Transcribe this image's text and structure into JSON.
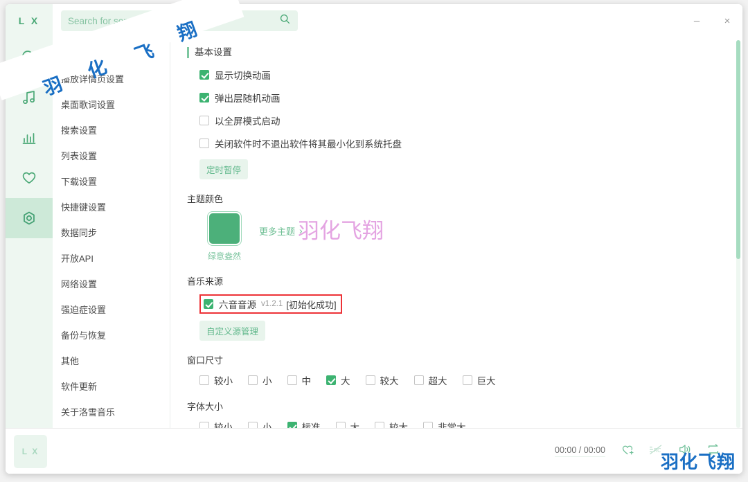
{
  "window": {
    "minimize_label": "–",
    "close_label": "×"
  },
  "rail": {
    "logo": "L X",
    "items": [
      {
        "name": "search",
        "label": "搜索"
      },
      {
        "name": "music-library",
        "label": "我的列表"
      },
      {
        "name": "ranking",
        "label": "排行榜"
      },
      {
        "name": "favorites",
        "label": "收藏"
      },
      {
        "name": "settings",
        "label": "设置"
      }
    ]
  },
  "search": {
    "placeholder": "Search for something...",
    "value": ""
  },
  "nav": {
    "group_label": "基本设置",
    "items": [
      "播放详情页设置",
      "桌面歌词设置",
      "搜索设置",
      "列表设置",
      "下载设置",
      "快捷键设置",
      "数据同步",
      "开放API",
      "网络设置",
      "强迫症设置",
      "备份与恢复",
      "其他",
      "软件更新",
      "关于洛雪音乐"
    ]
  },
  "panel": {
    "basic": {
      "title": "基本设置",
      "checkboxes": [
        {
          "label": "显示切换动画",
          "checked": true
        },
        {
          "label": "弹出层随机动画",
          "checked": true
        },
        {
          "label": "以全屏模式启动",
          "checked": false
        },
        {
          "label": "关闭软件时不退出软件将其最小化到系统托盘",
          "checked": false
        }
      ],
      "timer_button": "定时暂停"
    },
    "theme": {
      "title": "主题颜色",
      "swatch_color": "#4cb07a",
      "swatch_name": "绿意盎然",
      "more_label": "更多主题",
      "more_chevron": "›"
    },
    "source": {
      "title": "音乐来源",
      "checked": true,
      "name": "六音音源",
      "version": "v1.2.1",
      "status": "[初始化成功]",
      "highlight_color": "#ed3237",
      "manage_button": "自定义源管理"
    },
    "window_size": {
      "title": "窗口尺寸",
      "options": [
        {
          "label": "较小",
          "checked": false
        },
        {
          "label": "小",
          "checked": false
        },
        {
          "label": "中",
          "checked": false
        },
        {
          "label": "大",
          "checked": true
        },
        {
          "label": "较大",
          "checked": false
        },
        {
          "label": "超大",
          "checked": false
        },
        {
          "label": "巨大",
          "checked": false
        }
      ]
    },
    "font_size": {
      "title": "字体大小",
      "options": [
        {
          "label": "较小",
          "checked": false
        },
        {
          "label": "小",
          "checked": false
        },
        {
          "label": "标准",
          "checked": true
        },
        {
          "label": "大",
          "checked": false
        },
        {
          "label": "较大",
          "checked": false
        },
        {
          "label": "非常大",
          "checked": false
        }
      ]
    }
  },
  "player": {
    "cover_label": "L X",
    "time": "00:00 / 00:00",
    "icons": [
      {
        "name": "add-to-favorites",
        "label": "收藏"
      },
      {
        "name": "lyric-toggle",
        "label": "歌词"
      },
      {
        "name": "volume",
        "label": "音量"
      },
      {
        "name": "repeat-mode",
        "label": "循环模式"
      }
    ]
  },
  "watermark": {
    "blue_chars": [
      "羽",
      "化",
      "飞",
      "翔"
    ],
    "pink_text": "羽化飞翔",
    "corner_text": "羽化飞翔",
    "blue_color": "#1a6fc4",
    "pink_color": "#e4a4e2"
  }
}
